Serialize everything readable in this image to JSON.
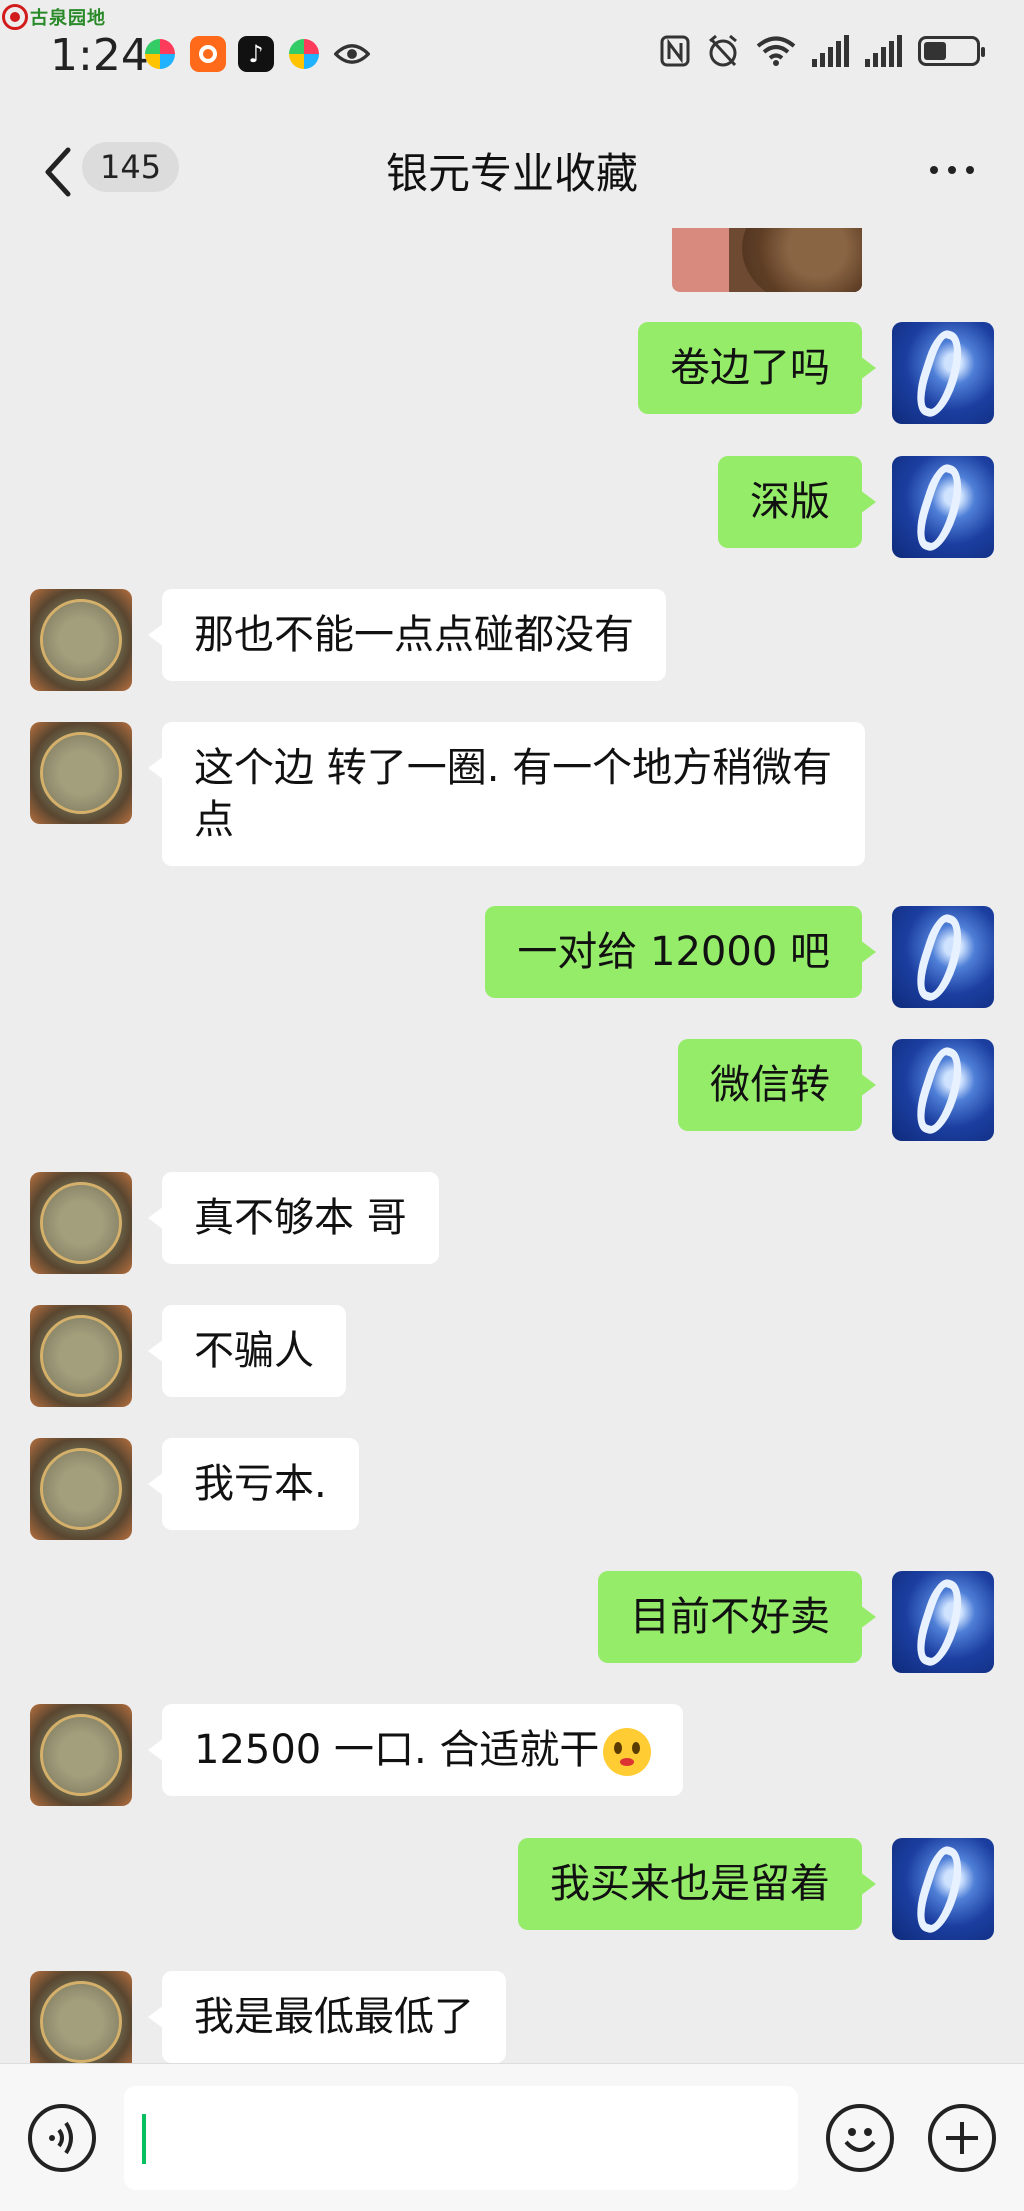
{
  "status_bar": {
    "watermark": "古泉园地",
    "time": "1:24",
    "app_icons": [
      "pinwheel-app-icon",
      "orange-app-icon",
      "tiktok-icon",
      "pinwheel-app-icon",
      "eye-icon"
    ],
    "system_icons": [
      "nfc-icon",
      "alarm-icon",
      "wifi-icon",
      "signal-icon",
      "signal-icon",
      "battery-icon"
    ]
  },
  "header": {
    "unread_count": "145",
    "title": "银元专业收藏"
  },
  "messages": [
    {
      "from": "me",
      "text": "卷边了吗"
    },
    {
      "from": "me",
      "text": "深版"
    },
    {
      "from": "them",
      "text": "那也不能一点点碰都没有"
    },
    {
      "from": "them",
      "text": "这个边 转了一圈. 有一个地方稍微有点"
    },
    {
      "from": "me",
      "text": "一对给 12000 吧"
    },
    {
      "from": "me",
      "text": "微信转"
    },
    {
      "from": "them",
      "text": "真不够本 哥"
    },
    {
      "from": "them",
      "text": "不骗人"
    },
    {
      "from": "them",
      "text": "我亏本."
    },
    {
      "from": "me",
      "text": "目前不好卖"
    },
    {
      "from": "them",
      "text": " 12500 一口. 合适就干",
      "emoji": "flushed-face-emoji"
    },
    {
      "from": "me",
      "text": "我买来也是留着"
    },
    {
      "from": "them",
      "text": "我是最低最低了"
    }
  ],
  "input": {
    "value": ""
  },
  "colors": {
    "my_bubble": "#95ec69",
    "their_bubble": "#ffffff",
    "background": "#ededed",
    "caret": "#07c160"
  }
}
